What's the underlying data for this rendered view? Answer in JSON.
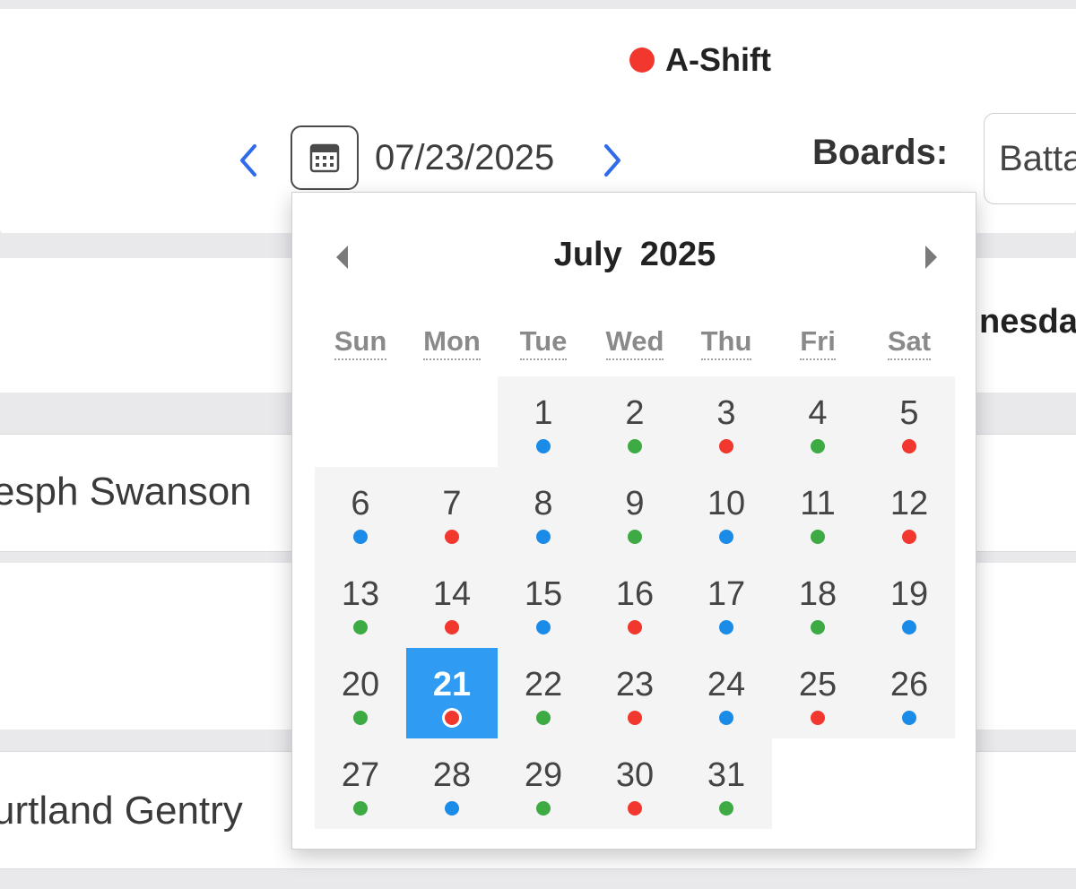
{
  "colors": {
    "red": "#f1372e",
    "green": "#3daa44",
    "blue": "#1b8be8",
    "accent": "#2f9bf2",
    "nav": "#2f6bea"
  },
  "shift": {
    "label": "A-Shift",
    "color": "red"
  },
  "toolbar": {
    "date_value": "07/23/2025",
    "boards_label": "Boards:",
    "boards_selected": "Batta"
  },
  "table": {
    "column_header": "nesda",
    "rows": [
      "esph Swanson",
      "urtland Gentry"
    ]
  },
  "calendar": {
    "month": "July",
    "year": "2025",
    "weekdays": [
      "Sun",
      "Mon",
      "Tue",
      "Wed",
      "Thu",
      "Fri",
      "Sat"
    ],
    "selected_day": 21,
    "weeks": [
      [
        null,
        null,
        {
          "day": 1,
          "marker": "blue"
        },
        {
          "day": 2,
          "marker": "green"
        },
        {
          "day": 3,
          "marker": "red"
        },
        {
          "day": 4,
          "marker": "green"
        },
        {
          "day": 5,
          "marker": "red"
        }
      ],
      [
        {
          "day": 6,
          "marker": "blue"
        },
        {
          "day": 7,
          "marker": "red"
        },
        {
          "day": 8,
          "marker": "blue"
        },
        {
          "day": 9,
          "marker": "green"
        },
        {
          "day": 10,
          "marker": "blue"
        },
        {
          "day": 11,
          "marker": "green"
        },
        {
          "day": 12,
          "marker": "red"
        }
      ],
      [
        {
          "day": 13,
          "marker": "green"
        },
        {
          "day": 14,
          "marker": "red"
        },
        {
          "day": 15,
          "marker": "blue"
        },
        {
          "day": 16,
          "marker": "red"
        },
        {
          "day": 17,
          "marker": "blue"
        },
        {
          "day": 18,
          "marker": "green"
        },
        {
          "day": 19,
          "marker": "blue"
        }
      ],
      [
        {
          "day": 20,
          "marker": "green"
        },
        {
          "day": 21,
          "marker": "red"
        },
        {
          "day": 22,
          "marker": "green"
        },
        {
          "day": 23,
          "marker": "red"
        },
        {
          "day": 24,
          "marker": "blue"
        },
        {
          "day": 25,
          "marker": "red"
        },
        {
          "day": 26,
          "marker": "blue"
        }
      ],
      [
        {
          "day": 27,
          "marker": "green"
        },
        {
          "day": 28,
          "marker": "blue"
        },
        {
          "day": 29,
          "marker": "green"
        },
        {
          "day": 30,
          "marker": "red"
        },
        {
          "day": 31,
          "marker": "green"
        },
        null,
        null
      ]
    ]
  }
}
